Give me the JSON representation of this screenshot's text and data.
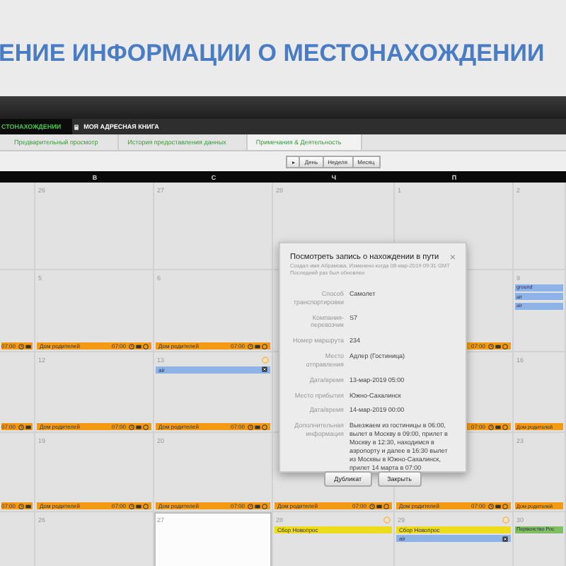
{
  "slide_title": "ЕНИЕ ИНФОРМАЦИИ О МЕСТОНАХОЖДЕНИИ",
  "top_tabs": [
    {
      "label": "СТОНАХОЖДЕНИИ",
      "selected": true
    },
    {
      "label": "МОЯ АДРЕСНАЯ КНИГА",
      "selected": false
    }
  ],
  "sub_tabs": [
    {
      "label": "Предварительный просмотр",
      "selected": false
    },
    {
      "label": "История предоставления данных",
      "selected": false
    },
    {
      "label": "Примечания & Деятельность",
      "selected": true
    }
  ],
  "view_buttons": [
    "▸",
    "День",
    "Неделя",
    "Месяц"
  ],
  "day_headers": [
    "В",
    "С",
    "Ч",
    "П"
  ],
  "weeks": [
    {
      "cells": [
        {
          "today": false,
          "alert": false
        },
        {
          "date": "26",
          "today": false,
          "alert": false
        },
        {
          "date": "27",
          "today": false,
          "alert": false
        },
        {
          "date": "28",
          "today": false,
          "alert": false
        },
        {
          "date": "1",
          "today": false,
          "alert": false
        },
        {
          "date": "2",
          "today": false,
          "alert": false
        }
      ]
    },
    {
      "cells": [
        {
          "today": false,
          "alert": false,
          "footer": {
            "time": "07:00",
            "color": "#f39a12"
          }
        },
        {
          "date": "5",
          "today": false,
          "alert": false,
          "footer": {
            "label": "Дом родителей",
            "time": "07:00",
            "color": "#f39a12"
          }
        },
        {
          "date": "6",
          "today": false,
          "alert": false,
          "footer": {
            "label": "Дом родителей",
            "time": "07:00",
            "color": "#f39a12"
          }
        },
        {
          "today": false,
          "alert": false
        },
        {
          "today": false,
          "alert": false,
          "footer": {
            "time": "07:00",
            "color": "#f39a12"
          }
        },
        {
          "date": "9",
          "today": false,
          "alert": false,
          "events": [
            {
              "label": "ground",
              "color": "#8db3e8",
              "removable": false
            },
            {
              "label": "air",
              "color": "#8db3e8",
              "removable": false
            },
            {
              "label": "air",
              "color": "#8db3e8",
              "removable": false
            }
          ]
        }
      ]
    },
    {
      "cells": [
        {
          "today": false,
          "alert": false,
          "footer": {
            "time": "07:00",
            "color": "#f39a12"
          }
        },
        {
          "date": "12",
          "today": false,
          "alert": false,
          "footer": {
            "label": "Дом родителей",
            "time": "07:00",
            "color": "#f39a12"
          }
        },
        {
          "date": "13",
          "today": false,
          "alert": true,
          "events": [
            {
              "label": "air",
              "color": "#8db3e8",
              "removable": true
            }
          ],
          "footer": {
            "label": "Дом родителей",
            "time": "07:00",
            "color": "#f39a12"
          }
        },
        {
          "today": false,
          "alert": false
        },
        {
          "today": false,
          "alert": false,
          "footer": {
            "time": "07:00",
            "color": "#f39a12"
          }
        },
        {
          "date": "16",
          "today": false,
          "alert": false,
          "footer": {
            "label": "Дом родителей",
            "color": "#f39a12"
          }
        }
      ]
    },
    {
      "cells": [
        {
          "today": false,
          "alert": false,
          "footer": {
            "time": "07:00",
            "color": "#f39a12"
          }
        },
        {
          "date": "19",
          "today": false,
          "alert": false,
          "footer": {
            "label": "Дом родителей",
            "time": "07:00",
            "color": "#f39a12"
          }
        },
        {
          "date": "20",
          "today": false,
          "alert": false,
          "footer": {
            "label": "Дом родителей",
            "time": "07:00",
            "color": "#f39a12"
          }
        },
        {
          "today": false,
          "alert": false,
          "footer": {
            "label": "Дом родителей",
            "time": "07:00",
            "color": "#f39a12"
          }
        },
        {
          "today": false,
          "alert": false,
          "footer": {
            "label": "Дом родителей",
            "time": "07:00",
            "color": "#f39a12"
          }
        },
        {
          "date": "23",
          "today": false,
          "alert": false,
          "footer": {
            "label": "Дом родителей",
            "color": "#f39a12"
          }
        }
      ]
    },
    {
      "cells": [
        {
          "today": false,
          "alert": false
        },
        {
          "date": "26",
          "today": false,
          "alert": false
        },
        {
          "date": "27",
          "today": true,
          "alert": false
        },
        {
          "date": "28",
          "today": false,
          "alert": true,
          "events": [
            {
              "label": "Сбор Новопрос",
              "color": "#ecdc1c",
              "removable": false
            }
          ]
        },
        {
          "date": "29",
          "today": false,
          "alert": true,
          "events": [
            {
              "label": "Сбор Новопрос",
              "color": "#ecdc1c",
              "removable": false
            },
            {
              "label": "air",
              "color": "#8db3e8",
              "removable": true
            }
          ]
        },
        {
          "date": "30",
          "today": false,
          "alert": false,
          "events": [
            {
              "label": "Первенство Рос",
              "color": "#7fbf62",
              "removable": false
            }
          ]
        }
      ]
    }
  ],
  "dialog": {
    "title": "Посмотреть запись о нахождении в пути",
    "close": "×",
    "meta": [
      "Создал имя Абрамова, Изменено когда 08-мар-2019 09:31 GMT",
      "Последний раз был обновлен"
    ],
    "fields": [
      {
        "label": "Способ транспортировки",
        "value": "Самолет"
      },
      {
        "label": "Компания-перевозчик",
        "value": "S7"
      },
      {
        "label": "Номер маршрута",
        "value": "234"
      },
      {
        "label": "Место отправления",
        "value": "Адлер (Гостиница)"
      },
      {
        "label": "Дата/время",
        "value": "13-мар-2019 05:00"
      },
      {
        "label": "Место прибытия",
        "value": "Южно-Сахалинск"
      },
      {
        "label": "Дата/время",
        "value": "14-мар-2019 00:00"
      },
      {
        "label": "Дополнительная информация",
        "value": "Выезжаем из гостиницы в 06:00, вылет в Москву в 09:00, прилет в Москву в 12:30, находимся в аэропорту и далее в 16:30 вылет из Москвы в Южно-Сахалинск, прилет 14 марта в 07:00"
      }
    ],
    "buttons": [
      "Дубликат",
      "Закрыть"
    ]
  }
}
